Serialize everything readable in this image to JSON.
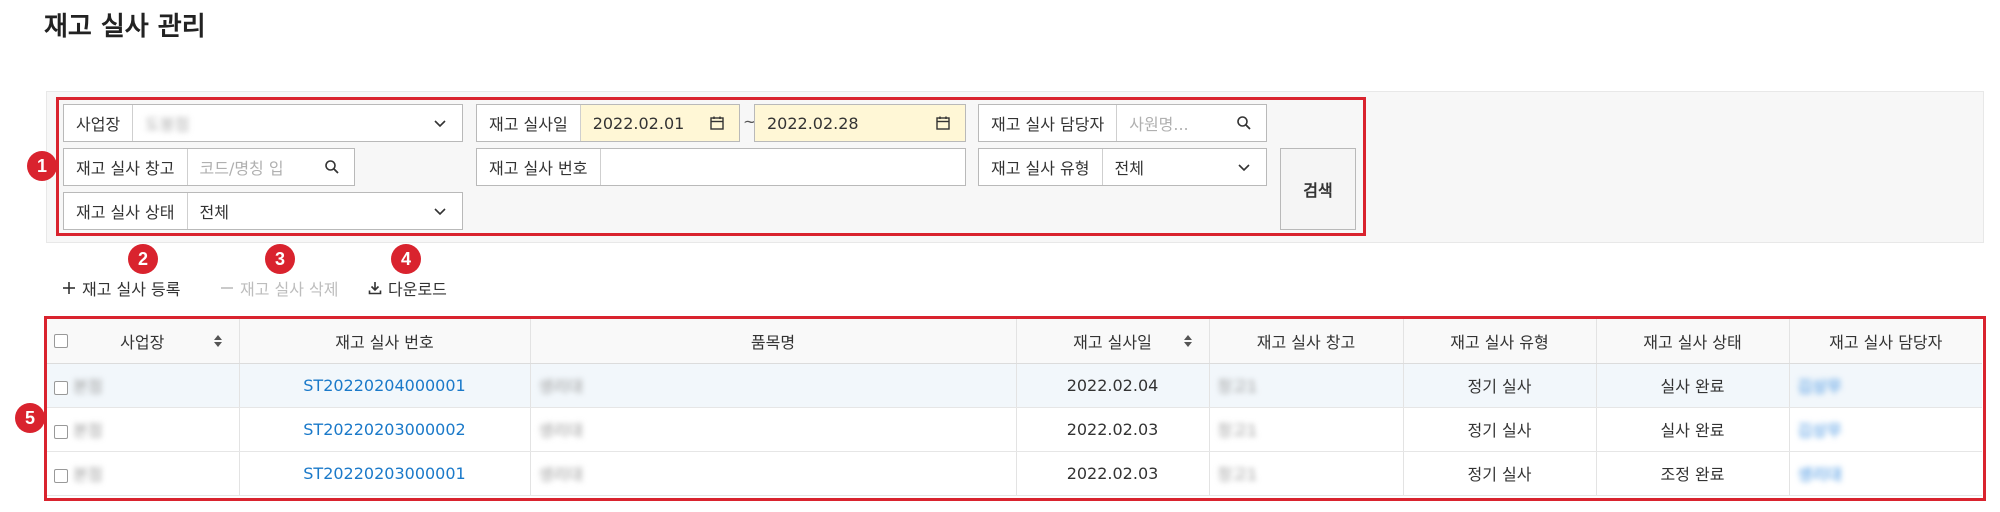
{
  "page": {
    "title": "재고 실사 관리"
  },
  "filters": {
    "site": {
      "label": "사업장",
      "value": "도봉점"
    },
    "date": {
      "label": "재고 실사일",
      "from": "2022.02.01",
      "to": "2022.02.28",
      "separator": "~"
    },
    "manager": {
      "label": "재고 실사 담당자",
      "placeholder": "사원명..."
    },
    "warehouse": {
      "label": "재고 실사 창고",
      "placeholder": "코드/명칭 입"
    },
    "number": {
      "label": "재고 실사 번호",
      "value": ""
    },
    "type": {
      "label": "재고 실사 유형",
      "value": "전체"
    },
    "status": {
      "label": "재고 실사 상태",
      "value": "전체"
    },
    "search_label": "검색"
  },
  "badges": [
    "1",
    "2",
    "3",
    "4",
    "5"
  ],
  "actions": {
    "register": "재고 실사 등록",
    "delete": "재고 실사 삭제",
    "download": "다운로드"
  },
  "table": {
    "headers": [
      "사업장",
      "재고 실사 번호",
      "품목명",
      "재고 실사일",
      "재고 실사 창고",
      "재고 실사 유형",
      "재고 실사 상태",
      "재고 실사 담당자"
    ],
    "rows": [
      {
        "site": "본점",
        "number": "ST20220204000001",
        "item": "생리대",
        "date": "2022.02.04",
        "warehouse": "창고1",
        "type": "정기 실사",
        "status": "실사 완료",
        "manager": "김상무"
      },
      {
        "site": "본점",
        "number": "ST20220203000002",
        "item": "생리대",
        "date": "2022.02.03",
        "warehouse": "창고1",
        "type": "정기 실사",
        "status": "실사 완료",
        "manager": "김상무"
      },
      {
        "site": "본점",
        "number": "ST20220203000001",
        "item": "생리대",
        "date": "2022.02.03",
        "warehouse": "창고1",
        "type": "정기 실사",
        "status": "조정 완료",
        "manager": "생리대"
      }
    ]
  },
  "colors": {
    "highlight": "#d9232e",
    "link": "#1a79c9",
    "date_bg": "#fff7d6"
  },
  "icons": [
    "chevron-down-icon",
    "calendar-icon",
    "search-icon",
    "plus-icon",
    "minus-icon",
    "download-icon",
    "sort-icon"
  ]
}
